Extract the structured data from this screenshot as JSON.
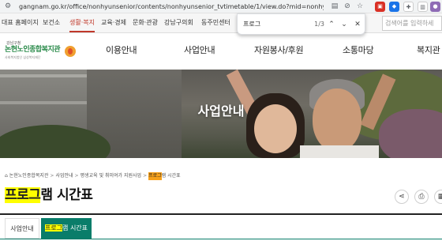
{
  "browser": {
    "url": "gangnam.go.kr/office/nonhyunsenior/contents/nonhyunsenior_tvtimetable/1/view.do?mid=nonhyunsenior_edu..."
  },
  "site_tabs": {
    "items": [
      "대표 홈페이지",
      "보건소",
      "생활·복지",
      "교육·경제",
      "문화·관광",
      "강남구의회",
      "동주민센터"
    ],
    "active_index": 2,
    "search_placeholder": "검색어를 입력하세"
  },
  "find_bar": {
    "query": "프로그",
    "count": "1/3"
  },
  "logo": {
    "small_text": "강남구청",
    "name": "논현노인종합복지관",
    "sub_text": "사회복지법인 삼성복지재단"
  },
  "main_nav": [
    "이용안내",
    "사업안내",
    "자원봉사/후원",
    "소통마당",
    "복지관"
  ],
  "hero": {
    "title": "사업안내"
  },
  "breadcrumb": {
    "items": [
      "논현노인종합복지관",
      "사업안내",
      "평생교육 및 취미여가 지원사업"
    ],
    "current_hl": "프로그",
    "current_rest": "램 시간표"
  },
  "page_title": {
    "highlight": "프로그",
    "rest": "램 시간표"
  },
  "sub_tabs": {
    "plain": "사업안내",
    "active_hl": "프로그",
    "active_rest": "램 시간표"
  },
  "colors": {
    "accent_green": "#0a7d6a",
    "highlight_yellow": "#ffff00",
    "highlight_current": "#f7a11a",
    "active_tab_red": "#c0392b"
  }
}
